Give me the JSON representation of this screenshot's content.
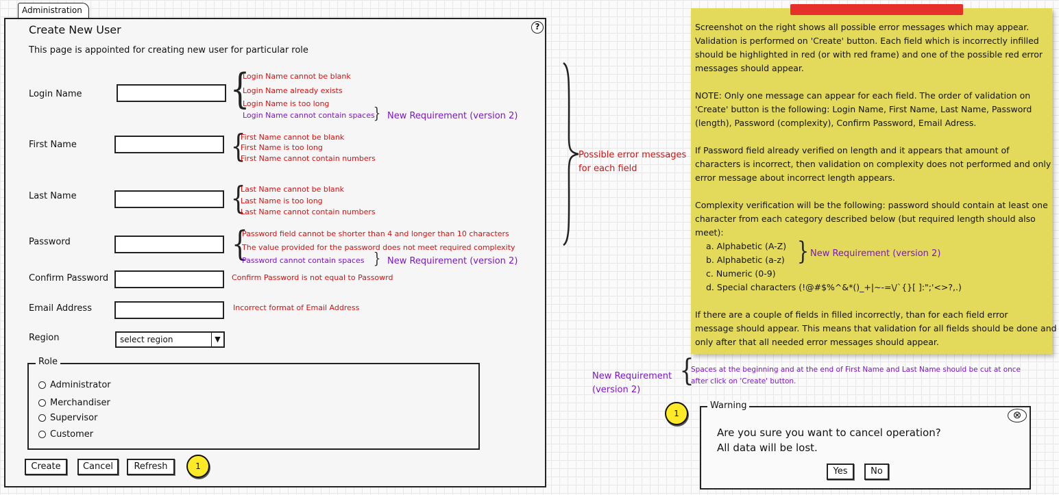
{
  "tab": {
    "label": "Administration"
  },
  "form": {
    "title": "Create New User",
    "help": "?",
    "description": "This page is appointed for creating new user for particular role",
    "fields": {
      "login": {
        "label": "Login Name",
        "value": ""
      },
      "first": {
        "label": "First Name",
        "value": ""
      },
      "last": {
        "label": "Last Name",
        "value": ""
      },
      "password": {
        "label": "Password",
        "value": ""
      },
      "confirm": {
        "label": "Confirm Password",
        "value": ""
      },
      "email": {
        "label": "Email Address",
        "value": ""
      },
      "region": {
        "label": "Region",
        "selected": "select region"
      }
    },
    "errors": {
      "login": [
        "Login Name cannot be blank",
        "Login Name already exists",
        "Login Name is too long",
        "Login Name cannot contain spaces"
      ],
      "first": [
        "First Name cannot be blank",
        "First Name is too long",
        "First Name cannot contain numbers"
      ],
      "last": [
        "Last Name cannot be blank",
        "Last Name is too long",
        "Last Name cannot contain numbers"
      ],
      "password": [
        "Password field cannot be shorter than 4 and longer than 10 characters",
        "The value provided for the password does not meet required complexity",
        "Password cannot contain spaces"
      ],
      "confirm": "Confirm Password is not equal to Passowrd",
      "email": "Incorrect format of Email Address"
    },
    "new_requirement": "New Requirement (version 2)",
    "role": {
      "legend": "Role",
      "options": [
        "Administrator",
        "Merchandiser",
        "Supervisor",
        "Customer"
      ]
    },
    "buttons": {
      "create": "Create",
      "cancel": "Cancel",
      "refresh": "Refresh"
    },
    "callout": "1"
  },
  "annotations": {
    "possible_errors": [
      "Possible error messages",
      "for each field"
    ],
    "new_requirement_side": [
      "New Requirement",
      "(version 2)"
    ],
    "spaces_note": [
      "Spaces at the beginning and at the end of First Name and Last Name should be cut at once",
      "after click on 'Create' button."
    ]
  },
  "sticky_note": {
    "lines": [
      "Screenshot on the right shows all possible error messages which may appear.",
      "Validation is performed on 'Create' button. Each field which is incorrectly infilled",
      "should be highlighted in red (or with red frame) and one of the possible red error",
      "messages should appear.",
      "",
      "NOTE: Only one message can appear for each field. The order of validation on",
      "'Create' button is the following: Login Name, First Name, Last Name, Password",
      "(length), Password (complexity), Confirm Password, Email Adress.",
      "",
      "If Password field already verified on length and it appears that amount of",
      "characters is incorrect, then validation on complexity does not performed and only",
      "error message about incorrect length appears.",
      "",
      "Complexity verification will be the following: password should contain at least one",
      "character from each category described below (but required length should also",
      "meet):"
    ],
    "list": [
      "a. Alphabetic (A-Z)",
      "b. Alphabetic (a-z)",
      "c. Numeric (0-9)",
      "d. Special characters (!@#$%^&*()_+|~-=\\/`{}[ ]:\";'<>?,.)"
    ],
    "list_new_requirement": "New Requirement (version 2)",
    "tail": [
      "If there are a couple of fields in filled incorrectly, than for each field error",
      "message should appear. This means that validation for all fields should be done and",
      "only after that all needed error messages should appear."
    ]
  },
  "dialog": {
    "title": "Warning",
    "message": [
      "Are you sure you want to cancel operation?",
      "All data will be lost."
    ],
    "yes": "Yes",
    "no": "No",
    "callout": "1"
  },
  "colors": {
    "error": "#d51111",
    "new_requirement": "#7a17c6",
    "sticky_note": "#e3d95a",
    "tape": "#e5302b",
    "callout": "#ffea28"
  }
}
